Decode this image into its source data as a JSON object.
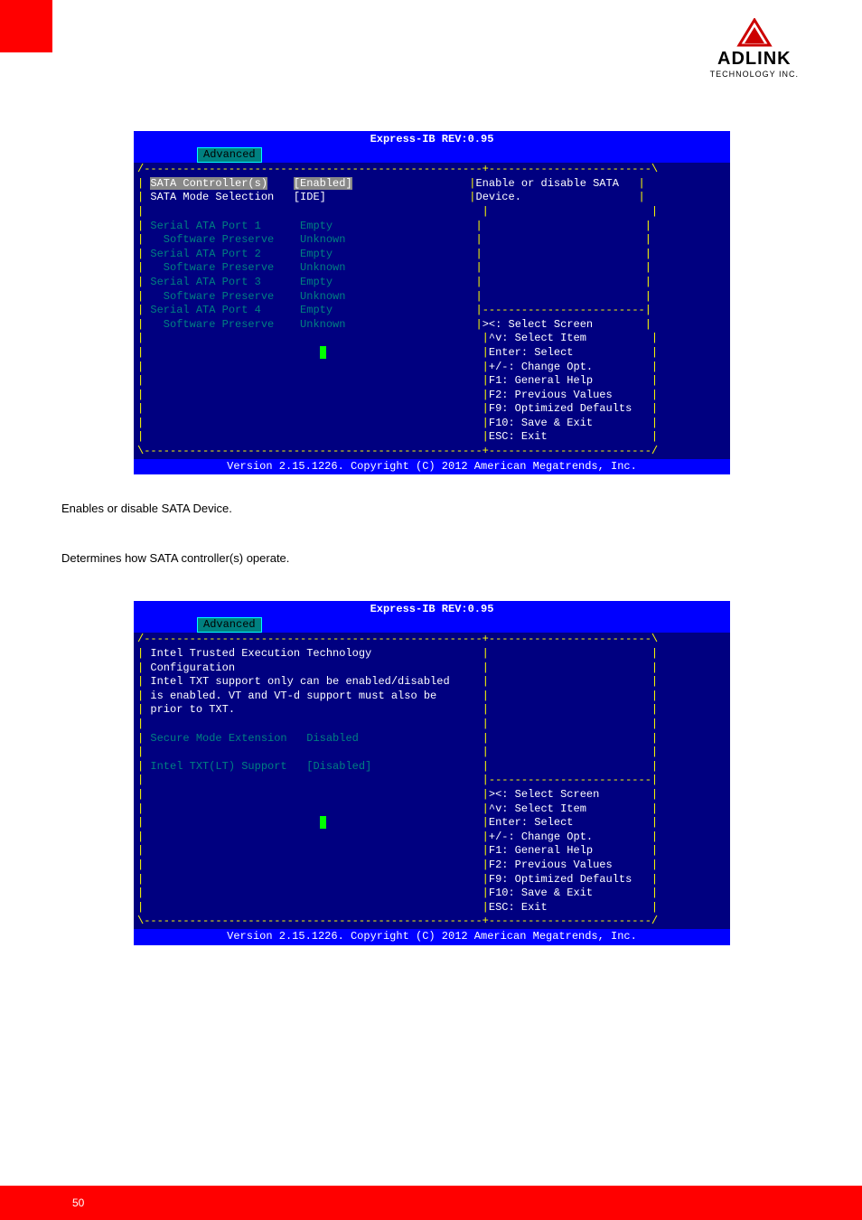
{
  "logo": {
    "main": "ADLINK",
    "sub": "TECHNOLOGY INC."
  },
  "page_number": "50",
  "screen1": {
    "title": "Express-IB REV:0.95",
    "tab": "Advanced",
    "rows": [
      {
        "label": "SATA Controller(s)",
        "value": "[Enabled]",
        "selected": true
      },
      {
        "label": "SATA Mode Selection",
        "value": "[IDE]",
        "hl": true
      }
    ],
    "ports": [
      {
        "label": "Serial ATA Port 1",
        "value": "Empty"
      },
      {
        "label": "  Software Preserve",
        "value": "Unknown"
      },
      {
        "label": "Serial ATA Port 2",
        "value": "Empty"
      },
      {
        "label": "  Software Preserve",
        "value": "Unknown"
      },
      {
        "label": "Serial ATA Port 3",
        "value": "Empty"
      },
      {
        "label": "  Software Preserve",
        "value": "Unknown"
      },
      {
        "label": "Serial ATA Port 4",
        "value": "Empty"
      },
      {
        "label": "  Software Preserve",
        "value": "Unknown"
      }
    ],
    "help": [
      "Enable or disable SATA",
      "Device."
    ],
    "keys": [
      "><: Select Screen",
      "^v: Select Item",
      "Enter: Select",
      "+/-: Change Opt.",
      "F1: General Help",
      "F2: Previous Values",
      "F9: Optimized Defaults",
      "F10: Save & Exit",
      "ESC: Exit"
    ],
    "footer": "Version 2.15.1226. Copyright (C) 2012 American Megatrends, Inc."
  },
  "desc1": "Enables or disable SATA Device.",
  "desc2": "Determines how SATA controller(s) operate.",
  "screen2": {
    "title": "Express-IB REV:0.95",
    "tab": "Advanced",
    "intro": [
      "Intel Trusted Execution Technology",
      "Configuration",
      "Intel TXT support only can be enabled/disabled",
      "is enabled. VT and VT-d support must also be",
      "prior to TXT."
    ],
    "rows": [
      {
        "label": "Secure Mode Extension",
        "value": "Disabled"
      },
      {
        "label": "Intel TXT(LT) Support",
        "value": "[Disabled]"
      }
    ],
    "keys": [
      "><: Select Screen",
      "^v: Select Item",
      "Enter: Select",
      "+/-: Change Opt.",
      "F1: General Help",
      "F2: Previous Values",
      "F9: Optimized Defaults",
      "F10: Save & Exit",
      "ESC: Exit"
    ],
    "footer": "Version 2.15.1226. Copyright (C) 2012 American Megatrends, Inc."
  }
}
